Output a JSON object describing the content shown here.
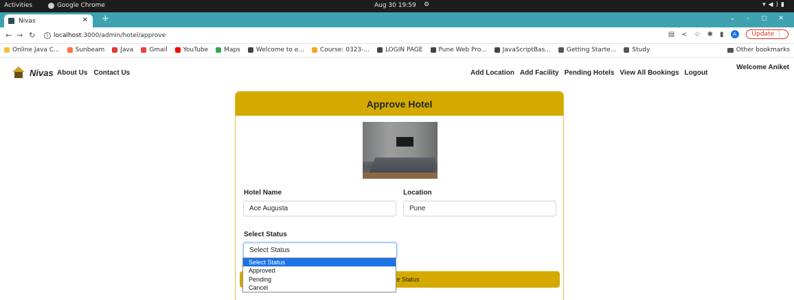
{
  "os_bar": {
    "activities": "Activities",
    "app_name": "Google Chrome",
    "datetime": "Aug 30  19:59"
  },
  "browser": {
    "tab_title": "Nivas",
    "url_host": "localhost",
    "url_rest": ":3000/admin/hotel/approve",
    "update_label": "Update",
    "avatar_letter": "A",
    "bookmarks": [
      {
        "label": "Online Java C...",
        "color": "#f2c12e"
      },
      {
        "label": "Sunbeam",
        "color": "#ff7043"
      },
      {
        "label": "Java",
        "color": "#e53935"
      },
      {
        "label": "Gmail",
        "color": "#ea4335"
      },
      {
        "label": "YouTube",
        "color": "#ff0000"
      },
      {
        "label": "Maps",
        "color": "#34a853"
      },
      {
        "label": "Welcome to e...",
        "color": "#444444"
      },
      {
        "label": "Course: 0323-...",
        "color": "#f5a623"
      },
      {
        "label": "LOGIN PAGE",
        "color": "#444444"
      },
      {
        "label": "Pune Web Pro...",
        "color": "#444444"
      },
      {
        "label": "JavaScriptBas...",
        "color": "#444444"
      },
      {
        "label": "Getting Starte...",
        "color": "#555555"
      },
      {
        "label": "Study",
        "color": "#555555"
      }
    ],
    "other_bookmarks": "Other bookmarks"
  },
  "navbar": {
    "brand": "Nivas",
    "left_links": [
      "About Us",
      "Contact Us"
    ],
    "right_links": [
      "Add Location",
      "Add Facility",
      "Pending Hotels",
      "View All Bookings",
      "Logout"
    ],
    "welcome": "Welcome Aniket"
  },
  "card": {
    "title": "Approve Hotel",
    "hotel_name_label": "Hotel Name",
    "hotel_name_value": "Ace Augusta",
    "location_label": "Location",
    "location_value": "Pune",
    "status_label": "Select Status",
    "status_value": "Select Status",
    "submit_label": "Update Status",
    "submit_visible_label": "e Status"
  },
  "dropdown": {
    "options": [
      "Select Status",
      "Approved",
      "Pending",
      "Cancel"
    ],
    "selected_index": 0
  },
  "colors": {
    "accent": "#d4aa00",
    "tab_strip": "#3fa2b1",
    "dropdown_highlight": "#1a73e8"
  }
}
